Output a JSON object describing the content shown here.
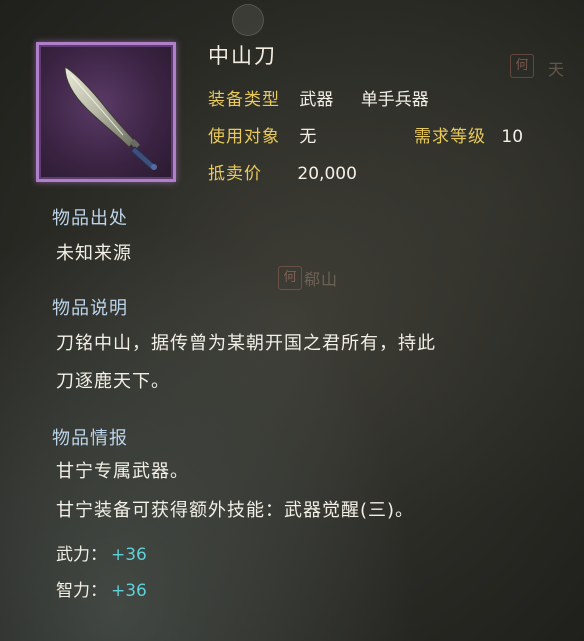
{
  "item": {
    "name": "中山刀",
    "equip_type_label": "装备类型",
    "equip_type_value": "武器",
    "equip_subtype_value": "单手兵器",
    "target_label": "使用对象",
    "target_value": "无",
    "level_req_label": "需求等级",
    "level_req_value": "10",
    "sell_price_label": "抵卖价",
    "sell_price_value": "20,000",
    "icon": "blade-icon",
    "frame_color": "#b07fc9"
  },
  "origin": {
    "title": "物品出处",
    "text": "未知来源"
  },
  "description": {
    "title": "物品说明",
    "lines": [
      "刀铭中山，据传曾为某朝开国之君所有，持此",
      "刀逐鹿天下。"
    ]
  },
  "intel": {
    "title": "物品情报",
    "lines": [
      "甘宁专属武器。",
      "甘宁装备可获得额外技能：武器觉醒(三)。"
    ]
  },
  "stats": [
    {
      "label": "武力：",
      "value": "+36"
    },
    {
      "label": "智力：",
      "value": "+36"
    }
  ],
  "background_map": {
    "labels": [
      "何",
      "天",
      "何",
      "郗山"
    ]
  },
  "colors": {
    "key_gold": "#e8c95a",
    "section_blue": "#bcd4ea",
    "stat_cyan": "#5fd0d8"
  }
}
